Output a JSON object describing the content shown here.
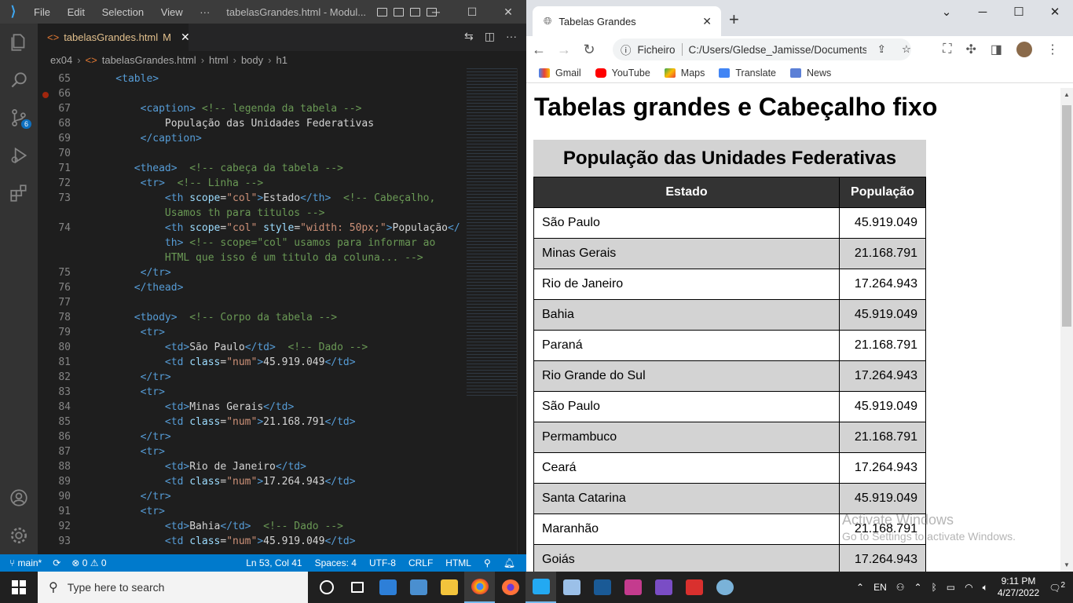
{
  "vscode": {
    "menu": [
      "File",
      "Edit",
      "Selection",
      "View",
      "···"
    ],
    "window_title": "tabelasGrandes.html - Modul...",
    "tab": {
      "name": "tabelasGrandes.html",
      "status": "M"
    },
    "breadcrumbs": [
      "ex04",
      "tabelasGrandes.html",
      "html",
      "body",
      "h1"
    ],
    "source_control_badge": "6",
    "status": {
      "branch": "main*",
      "errors": "0",
      "warnings": "0",
      "position": "Ln 53, Col 41",
      "spaces": "Spaces: 4",
      "encoding": "UTF-8",
      "eol": "CRLF",
      "language": "HTML"
    }
  },
  "browser": {
    "tab_title": "Tabelas Grandes",
    "url_label": "Ficheiro",
    "url": "C:/Users/Gledse_Jamisse/Documents/...",
    "bookmarks": [
      "Gmail",
      "YouTube",
      "Maps",
      "Translate",
      "News"
    ],
    "page": {
      "heading": "Tabelas grandes e Cabeçalho fixo",
      "caption": "População das Unidades Federativas",
      "col_state": "Estado",
      "col_pop": "População",
      "rows": [
        {
          "state": "São Paulo",
          "pop": "45.919.049"
        },
        {
          "state": "Minas Gerais",
          "pop": "21.168.791"
        },
        {
          "state": "Rio de Janeiro",
          "pop": "17.264.943"
        },
        {
          "state": "Bahia",
          "pop": "45.919.049"
        },
        {
          "state": "Paraná",
          "pop": "21.168.791"
        },
        {
          "state": "Rio Grande do Sul",
          "pop": "17.264.943"
        },
        {
          "state": "São Paulo",
          "pop": "45.919.049"
        },
        {
          "state": "Permambuco",
          "pop": "21.168.791"
        },
        {
          "state": "Ceará",
          "pop": "17.264.943"
        },
        {
          "state": "Santa Catarina",
          "pop": "45.919.049"
        },
        {
          "state": "Maranhão",
          "pop": "21.168.791"
        },
        {
          "state": "Goiás",
          "pop": "17.264.943"
        }
      ]
    },
    "watermark": {
      "title": "Activate Windows",
      "sub": "Go to Settings to activate Windows."
    }
  },
  "taskbar": {
    "search_placeholder": "Type here to search",
    "lang": "EN",
    "time": "9:11 PM",
    "date": "4/27/2022",
    "notif_count": "2"
  }
}
